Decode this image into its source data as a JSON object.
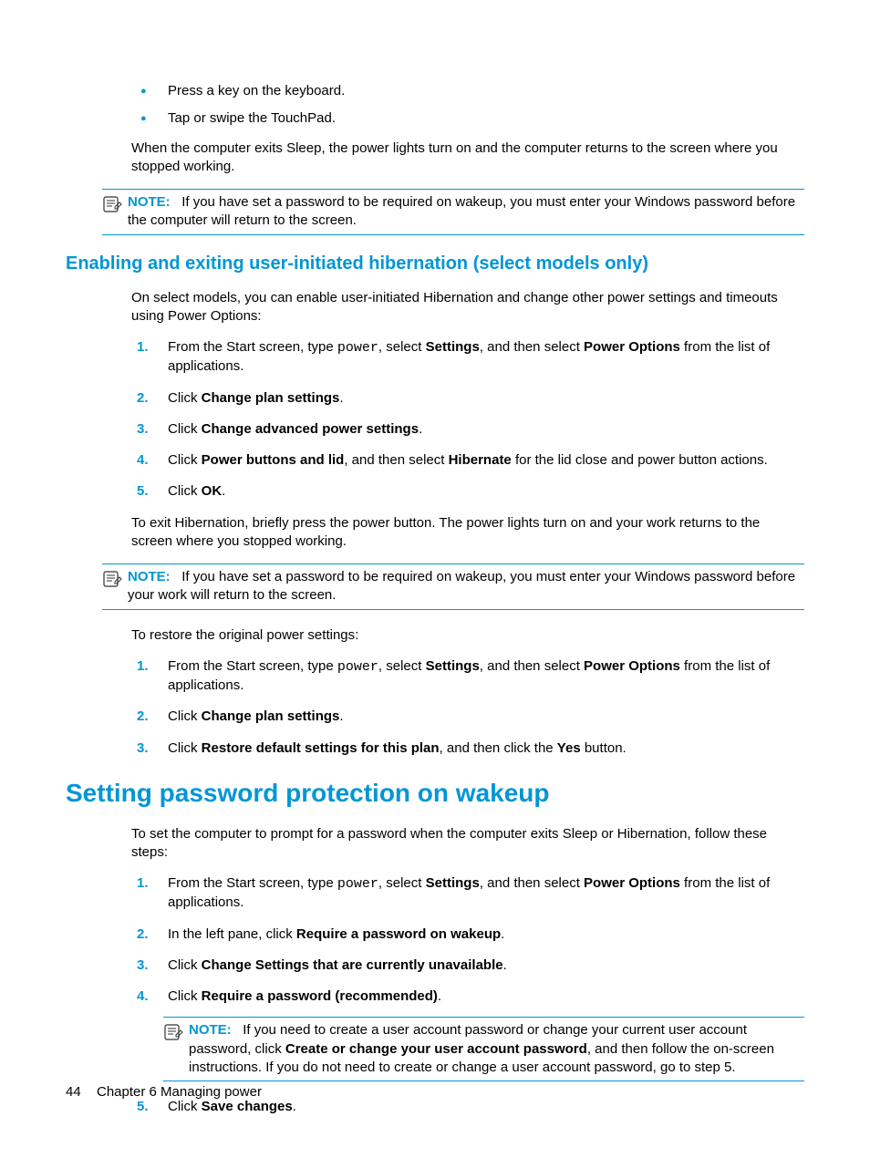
{
  "top": {
    "bullets": [
      "Press a key on the keyboard.",
      "Tap or swipe the TouchPad."
    ],
    "after_bullets": "When the computer exits Sleep, the power lights turn on and the computer returns to the screen where you stopped working.",
    "note_label": "NOTE:",
    "note_text": "If you have set a password to be required on wakeup, you must enter your Windows password before the computer will return to the screen."
  },
  "hibernation": {
    "heading": "Enabling and exiting user-initiated hibernation (select models only)",
    "intro": "On select models, you can enable user-initiated Hibernation and change other power settings and timeouts using Power Options:",
    "steps1": {
      "s1_a": "From the Start screen, type ",
      "s1_mono": "power",
      "s1_b": ", select ",
      "s1_bold1": "Settings",
      "s1_c": ", and then select ",
      "s1_bold2": "Power Options",
      "s1_d": " from the list of applications.",
      "s2_a": "Click ",
      "s2_bold": "Change plan settings",
      "s2_b": ".",
      "s3_a": "Click ",
      "s3_bold": "Change advanced power settings",
      "s3_b": ".",
      "s4_a": "Click ",
      "s4_bold1": "Power buttons and lid",
      "s4_b": ", and then select ",
      "s4_bold2": "Hibernate",
      "s4_c": " for the lid close and power button actions.",
      "s5_a": "Click ",
      "s5_bold": "OK",
      "s5_b": "."
    },
    "exit_text": "To exit Hibernation, briefly press the power button. The power lights turn on and your work returns to the screen where you stopped working.",
    "note_label": "NOTE:",
    "note_text": "If you have set a password to be required on wakeup, you must enter your Windows password before your work will return to the screen.",
    "restore_intro": "To restore the original power settings:",
    "steps2": {
      "s1_a": "From the Start screen, type ",
      "s1_mono": "power",
      "s1_b": ", select ",
      "s1_bold1": "Settings",
      "s1_c": ", and then select ",
      "s1_bold2": "Power Options",
      "s1_d": " from the list of applications.",
      "s2_a": "Click ",
      "s2_bold": "Change plan settings",
      "s2_b": ".",
      "s3_a": "Click ",
      "s3_bold": "Restore default settings for this plan",
      "s3_b": ", and then click the ",
      "s3_bold2": "Yes",
      "s3_c": " button."
    }
  },
  "password": {
    "heading": "Setting password protection on wakeup",
    "intro": "To set the computer to prompt for a password when the computer exits Sleep or Hibernation, follow these steps:",
    "steps": {
      "s1_a": "From the Start screen, type ",
      "s1_mono": "power",
      "s1_b": ", select ",
      "s1_bold1": "Settings",
      "s1_c": ", and then select ",
      "s1_bold2": "Power Options",
      "s1_d": " from the list of applications.",
      "s2_a": "In the left pane, click ",
      "s2_bold": "Require a password on wakeup",
      "s2_b": ".",
      "s3_a": "Click ",
      "s3_bold": "Change Settings that are currently unavailable",
      "s3_b": ".",
      "s4_a": "Click ",
      "s4_bold": "Require a password (recommended)",
      "s4_b": ".",
      "note_label": "NOTE:",
      "note_a": "If you need to create a user account password or change your current user account password, click ",
      "note_bold": "Create or change your user account password",
      "note_b": ", and then follow the on-screen instructions. If you do not need to create or change a user account password, go to step 5.",
      "s5_a": "Click ",
      "s5_bold": "Save changes",
      "s5_b": "."
    }
  },
  "footer": {
    "page_number": "44",
    "chapter": "Chapter 6   Managing power"
  }
}
